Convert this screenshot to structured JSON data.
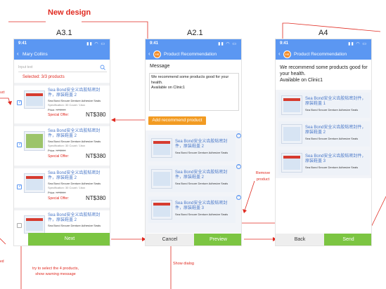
{
  "new_design_label": "New design",
  "annotations": {
    "left_edge_top": "uct",
    "left_edge_bottom": "ed",
    "warning_note_line1": "try to select the 4 products,",
    "warning_note_line2": "show warning message",
    "show_dialog": "Show dialog",
    "remove_product_line1": "Remove",
    "remove_product_line2": "product"
  },
  "colors": {
    "accent_blue": "#5b97f2",
    "annotation_red": "#e02a20",
    "green_button": "#7cc542",
    "orange_button": "#f29b22"
  },
  "frames": {
    "a31": {
      "title": "A3.1",
      "status_time": "9:41",
      "nav_title": "Mary Collins",
      "search_placeholder": "Input text",
      "selected_text": "Selected: 3/3 products",
      "products": [
        {
          "name": "Sea Bond安全义齿胶粘密封件，原装鞋盖 2",
          "subtitle": "Sea Bond Secure Denture Adhesive Seals",
          "spec": "Specification: 30 Count / 1box",
          "price_label": "Price:",
          "old_price": "NT$550",
          "offer_label": "Special Offer:",
          "offer_price": "NT$380",
          "checked": true
        },
        {
          "name": "Sea Bond安全义齿胶粘密封件，原装鞋盖 2",
          "subtitle": "Sea Bond Secure Denture Adhesive Seals",
          "spec": "Specification: 30 Count / 1box",
          "price_label": "Price:",
          "old_price": "NT$550",
          "offer_label": "Special Offer:",
          "offer_price": "NT$380",
          "checked": true
        },
        {
          "name": "Sea Bond安全义齿胶粘密封件，原装鞋盖 2",
          "subtitle": "Sea Bond Secure Denture Adhesive Seals",
          "spec": "Specification: 30 Count / 1box",
          "price_label": "Price:",
          "old_price": "NT$550",
          "offer_label": "Special Offer:",
          "offer_price": "NT$380",
          "checked": true
        },
        {
          "name": "Sea Bond安全义齿胶粘密封件，原装鞋盖 2",
          "subtitle": "Sea Bond Secure Denture Adhesive Seals",
          "checked": false
        }
      ],
      "next_label": "Next"
    },
    "a21": {
      "title": "A2.1",
      "status_time": "9:41",
      "logo_text": "HK",
      "nav_title": "Product Recommendation",
      "message_label": "Message",
      "message_text_line1": "We recommend some products good for your",
      "message_text_line2": "health.",
      "message_text_line3": "Available on Clinic1",
      "add_button": "Add recommend product",
      "products": [
        {
          "name": "Sea Bond安全义齿胶粘密封件，原装鞋盖 2",
          "subtitle": "Sea Bond Secure Denture Adhesive Seals"
        },
        {
          "name": "Sea Bond安全义齿胶粘密封件，原装鞋盖 2",
          "subtitle": "Sea Bond Secure Denture Adhesive Seals"
        },
        {
          "name": "Sea Bond安全义齿胶粘密封件，原装鞋盖 3",
          "subtitle": "Sea Bond Secure Denture Adhesive Seals"
        }
      ],
      "cancel_label": "Cancel",
      "preview_label": "Preview"
    },
    "a4": {
      "title": "A4",
      "status_time": "9:41",
      "logo_text": "HK",
      "nav_title": "Product Recommendation",
      "message_line1": "We recommend some products good for",
      "message_line2": "your health.",
      "message_line3": "Available on Clinic1",
      "products": [
        {
          "name": "Sea Bond安全义齿胶粘密封件，原装鞋盖 1",
          "subtitle": "Sea Bond Secure Denture Adhesive Seals"
        },
        {
          "name": "Sea Bond安全义齿胶粘密封件，原装鞋盖 2",
          "subtitle": "Sea Bond Secure Denture Adhesive Seals"
        },
        {
          "name": "Sea Bond安全义齿胶粘密封件，原装鞋盖 3",
          "subtitle": "Sea Bond Secure Denture Adhesive Seals"
        }
      ],
      "back_label": "Back",
      "send_label": "Send"
    }
  }
}
